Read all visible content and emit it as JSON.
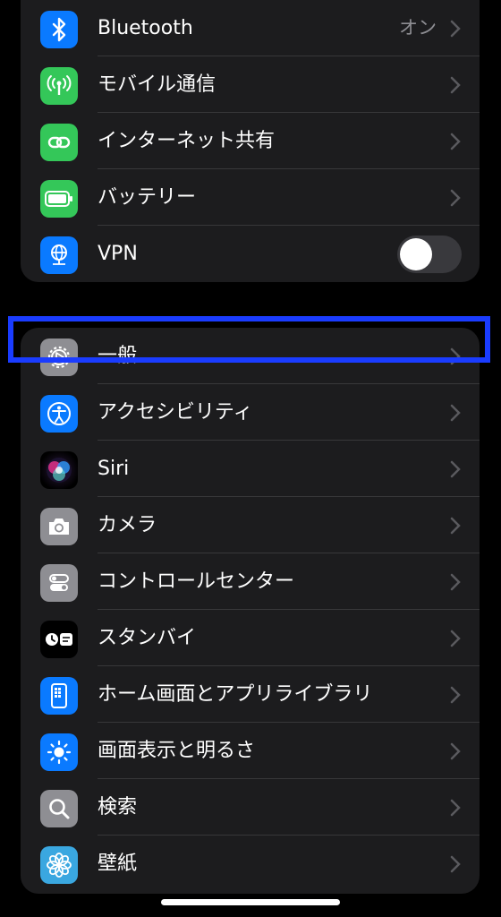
{
  "top_group": {
    "bluetooth": {
      "label": "Bluetooth",
      "value": "オン",
      "icon": "bluetooth-icon",
      "color": "#0a7aff"
    },
    "mobile": {
      "label": "モバイル通信",
      "icon": "antenna-icon",
      "color": "#34c759"
    },
    "hotspot": {
      "label": "インターネット共有",
      "icon": "link-icon",
      "color": "#34c759"
    },
    "battery": {
      "label": "バッテリー",
      "icon": "battery-icon",
      "color": "#34c759"
    },
    "vpn": {
      "label": "VPN",
      "icon": "globe-network-icon",
      "color": "#0a7aff",
      "toggle": false
    }
  },
  "settings_group": {
    "items": [
      {
        "label": "一般",
        "icon": "gear-icon",
        "color": "#8e8e93"
      },
      {
        "label": "アクセシビリティ",
        "icon": "accessibility-icon",
        "color": "#0a7aff"
      },
      {
        "label": "Siri",
        "icon": "siri-icon",
        "color": "#222"
      },
      {
        "label": "カメラ",
        "icon": "camera-icon",
        "color": "#8e8e93"
      },
      {
        "label": "コントロールセンター",
        "icon": "control-center-icon",
        "color": "#8e8e93"
      },
      {
        "label": "スタンバイ",
        "icon": "standby-icon",
        "color": "#000"
      },
      {
        "label": "ホーム画面とアプリライブラリ",
        "icon": "home-screen-icon",
        "color": "#0a7aff"
      },
      {
        "label": "画面表示と明るさ",
        "icon": "brightness-icon",
        "color": "#0a7aff"
      },
      {
        "label": "検索",
        "icon": "search-icon",
        "color": "#8e8e93"
      },
      {
        "label": "壁紙",
        "icon": "wallpaper-flower-icon",
        "color": "#3aa7e0"
      }
    ]
  },
  "highlight_color": "#1a3cff"
}
